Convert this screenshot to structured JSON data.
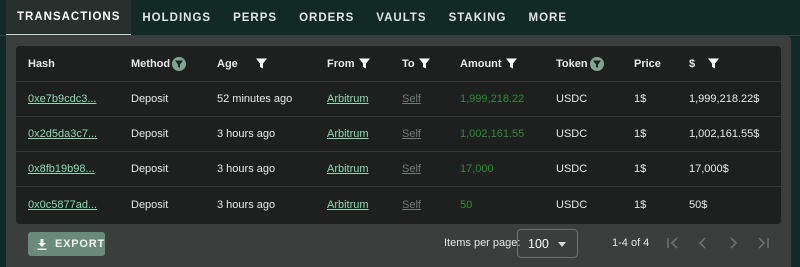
{
  "tabs": [
    {
      "label": "TRANSACTIONS",
      "active": true
    },
    {
      "label": "HOLDINGS",
      "active": false
    },
    {
      "label": "PERPS",
      "active": false
    },
    {
      "label": "ORDERS",
      "active": false
    },
    {
      "label": "VAULTS",
      "active": false
    },
    {
      "label": "STAKING",
      "active": false
    },
    {
      "label": "MORE",
      "active": false
    }
  ],
  "table": {
    "headers": {
      "hash": "Hash",
      "method": "Method",
      "age": "Age",
      "from": "From",
      "to": "To",
      "amount": "Amount",
      "token": "Token",
      "price": "Price",
      "usd": "$"
    },
    "rows": [
      {
        "hash": "0xe7b9cdc3...",
        "method": "Deposit",
        "age": "52 minutes ago",
        "from": "Arbitrum",
        "to": "Self",
        "amount": "1,999,218.22",
        "token": "USDC",
        "price": "1$",
        "usd": "1,999,218.22$"
      },
      {
        "hash": "0x2d5da3c7...",
        "method": "Deposit",
        "age": "3 hours ago",
        "from": "Arbitrum",
        "to": "Self",
        "amount": "1,002,161.55",
        "token": "USDC",
        "price": "1$",
        "usd": "1,002,161.55$"
      },
      {
        "hash": "0x8fb19b98...",
        "method": "Deposit",
        "age": "3 hours ago",
        "from": "Arbitrum",
        "to": "Self",
        "amount": "17,000",
        "token": "USDC",
        "price": "1$",
        "usd": "17,000$"
      },
      {
        "hash": "0x0c5877ad...",
        "method": "Deposit",
        "age": "3 hours ago",
        "from": "Arbitrum",
        "to": "Self",
        "amount": "50",
        "token": "USDC",
        "price": "1$",
        "usd": "50$"
      }
    ]
  },
  "footer": {
    "export_label": "EXPORT",
    "items_per_page_label": "Items per page:",
    "items_per_page_value": "100",
    "range_text": "1-4 of 4"
  },
  "colors": {
    "background": "#122a25",
    "panel": "#3a3e3d",
    "table": "#1e2020",
    "link": "#8ed8b4",
    "amount_green": "#2f8a34",
    "export_button": "#6a8a7d"
  },
  "icons": [
    "filter-icon",
    "filter-active-icon",
    "download-icon",
    "caret-down-icon",
    "first-page-icon",
    "prev-page-icon",
    "next-page-icon",
    "last-page-icon"
  ]
}
